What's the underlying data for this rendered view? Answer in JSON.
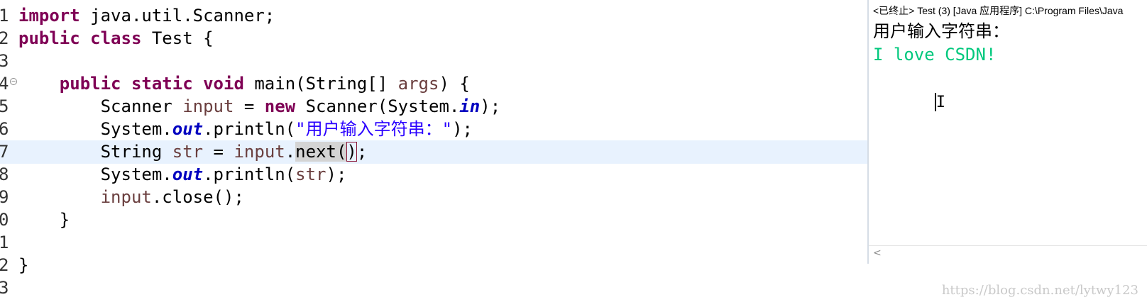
{
  "editor": {
    "lines": [
      {
        "num": "1",
        "segments": [
          {
            "cls": "kw",
            "text": "import"
          },
          {
            "cls": "",
            "text": " java.util.Scanner;"
          }
        ]
      },
      {
        "num": "2",
        "segments": [
          {
            "cls": "kw",
            "text": "public"
          },
          {
            "cls": "",
            "text": " "
          },
          {
            "cls": "kw",
            "text": "class"
          },
          {
            "cls": "",
            "text": " Test {"
          }
        ]
      },
      {
        "num": "3",
        "segments": []
      },
      {
        "num": "4",
        "fold": true,
        "segments": [
          {
            "cls": "",
            "text": "    "
          },
          {
            "cls": "kw",
            "text": "public"
          },
          {
            "cls": "",
            "text": " "
          },
          {
            "cls": "kw",
            "text": "static"
          },
          {
            "cls": "",
            "text": " "
          },
          {
            "cls": "kw",
            "text": "void"
          },
          {
            "cls": "",
            "text": " main(String[] "
          },
          {
            "cls": "var",
            "text": "args"
          },
          {
            "cls": "",
            "text": ") {"
          }
        ]
      },
      {
        "num": "5",
        "segments": [
          {
            "cls": "",
            "text": "        Scanner "
          },
          {
            "cls": "var",
            "text": "input"
          },
          {
            "cls": "",
            "text": " = "
          },
          {
            "cls": "kw",
            "text": "new"
          },
          {
            "cls": "",
            "text": " Scanner(System."
          },
          {
            "cls": "fld",
            "text": "in"
          },
          {
            "cls": "",
            "text": ");"
          }
        ]
      },
      {
        "num": "6",
        "segments": [
          {
            "cls": "",
            "text": "        System."
          },
          {
            "cls": "fld",
            "text": "out"
          },
          {
            "cls": "",
            "text": ".println("
          },
          {
            "cls": "str",
            "text": "\"用户输入字符串：\""
          },
          {
            "cls": "",
            "text": ");"
          }
        ]
      },
      {
        "num": "7",
        "current": true,
        "segments": [
          {
            "cls": "",
            "text": "        String "
          },
          {
            "cls": "var",
            "text": "str"
          },
          {
            "cls": "",
            "text": " = "
          },
          {
            "cls": "var",
            "text": "input"
          },
          {
            "cls": "",
            "text": "."
          },
          {
            "cls": "hl",
            "text": "next("
          },
          {
            "cls": "bracket",
            "text": ")"
          },
          {
            "cls": "",
            "text": ";"
          }
        ]
      },
      {
        "num": "8",
        "segments": [
          {
            "cls": "",
            "text": "        System."
          },
          {
            "cls": "fld",
            "text": "out"
          },
          {
            "cls": "",
            "text": ".println("
          },
          {
            "cls": "var",
            "text": "str"
          },
          {
            "cls": "",
            "text": ");"
          }
        ]
      },
      {
        "num": "9",
        "segments": [
          {
            "cls": "",
            "text": "        "
          },
          {
            "cls": "var",
            "text": "input"
          },
          {
            "cls": "",
            "text": ".close();"
          }
        ]
      },
      {
        "num": "0",
        "segments": [
          {
            "cls": "",
            "text": "    }"
          }
        ]
      },
      {
        "num": "1",
        "segments": []
      },
      {
        "num": "2",
        "segments": [
          {
            "cls": "",
            "text": "}"
          }
        ]
      },
      {
        "num": "3",
        "segments": []
      }
    ]
  },
  "console": {
    "header": "<已终止> Test (3) [Java 应用程序] C:\\Program Files\\Java",
    "output_line": "用户输入字符串：",
    "input_line": "I love CSDN!",
    "cursor_glyph": "I",
    "scroll_left_glyph": "<"
  },
  "watermark": "https://blog.csdn.net/lytwy123",
  "colors": {
    "keyword": "#7f0055",
    "field": "#0000c0",
    "variable": "#6a3e3e",
    "string": "#2a00ff",
    "console_input": "#00c87d",
    "current_line": "#e8f2fe"
  }
}
